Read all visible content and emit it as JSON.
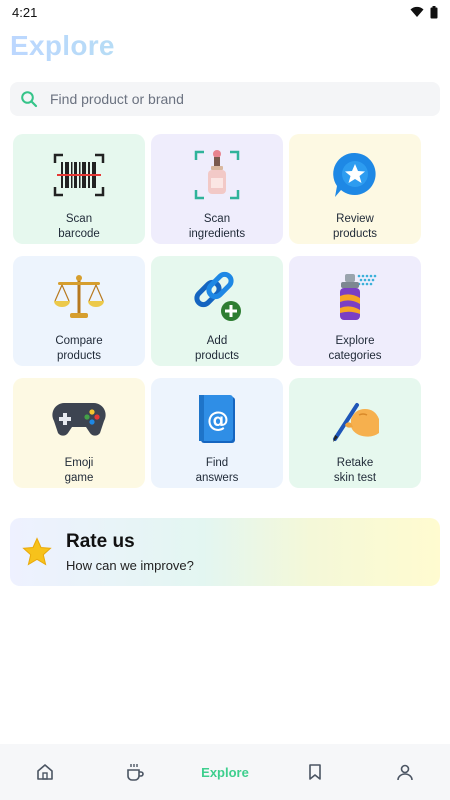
{
  "status": {
    "time": "4:21"
  },
  "header": {
    "title": "Explore"
  },
  "search": {
    "placeholder": "Find product or brand",
    "value": ""
  },
  "tiles": [
    {
      "label_line1": "Scan",
      "label_line2": "barcode",
      "icon": "barcode-icon"
    },
    {
      "label_line1": "Scan",
      "label_line2": "ingredients",
      "icon": "dropper-bottle-icon"
    },
    {
      "label_line1": "Review",
      "label_line2": "products",
      "icon": "star-bubble-icon"
    },
    {
      "label_line1": "Compare",
      "label_line2": "products",
      "icon": "scales-icon"
    },
    {
      "label_line1": "Add",
      "label_line2": "products",
      "icon": "link-add-icon"
    },
    {
      "label_line1": "Explore",
      "label_line2": "categories",
      "icon": "spray-can-icon"
    },
    {
      "label_line1": "Emoji",
      "label_line2": "game",
      "icon": "gamepad-icon"
    },
    {
      "label_line1": "Find",
      "label_line2": "answers",
      "icon": "book-at-icon"
    },
    {
      "label_line1": "Retake",
      "label_line2": "skin test",
      "icon": "writing-hand-icon"
    }
  ],
  "rate": {
    "title": "Rate us",
    "subtitle": "How can we improve?",
    "icon": "star-icon"
  },
  "nav": {
    "items": [
      "home-icon",
      "cup-icon",
      "Explore",
      "bookmark-icon",
      "profile-icon"
    ],
    "active_label": "Explore",
    "active_color": "#3ecf8e"
  },
  "colors": {
    "green_tile": "#e6f8ee",
    "purple_tile": "#efedfc",
    "yellow_tile": "#fdf9e3",
    "blue_tile": "#edf4fd"
  }
}
